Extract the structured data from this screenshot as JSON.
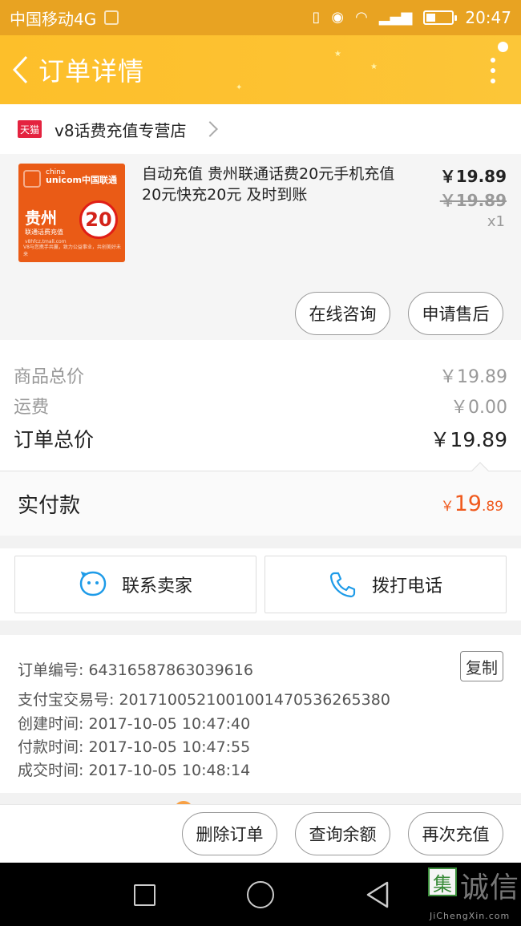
{
  "status_bar": {
    "carrier": "中国移动4G",
    "network": "4G",
    "time": "20:47",
    "battery_level": 0.35
  },
  "header": {
    "title": "订单详情"
  },
  "shop": {
    "badge": "天猫",
    "name": "v8话费充值专营店"
  },
  "product": {
    "thumb": {
      "brand_en_1": "china",
      "brand_en_2": "unicom",
      "brand_cn": "中国联通",
      "province": "贵州",
      "subtitle": "联通话费充值",
      "denomination": "20",
      "denomination_unit": "面值",
      "url": "v8hfcz.tmall.com",
      "footer": "V8与您携手共赢，致力公益事业，共创美好未来"
    },
    "title": "自动充值 贵州联通话费20元手机充值20元快充20元 及时到账",
    "price": "￥19.89",
    "original_price": "￥19.89",
    "quantity": "x1",
    "consult_label": "在线咨询",
    "after_sale_label": "申请售后"
  },
  "pricing": {
    "goods_total_label": "商品总价",
    "goods_total": "￥19.89",
    "shipping_label": "运费",
    "shipping": "￥0.00",
    "order_total_label": "订单总价",
    "order_total": "￥19.89"
  },
  "paid": {
    "label": "实付款",
    "currency": "￥",
    "integer": "19",
    "decimal": ".89"
  },
  "contact": {
    "seller_label": "联系卖家",
    "call_label": "拨打电话"
  },
  "order_info": {
    "order_no": "订单编号: 64316587863039616",
    "alipay_no": "支付宝交易号: 2017100521001001470536265380",
    "created": "创建时间: 2017-10-05 10:47:40",
    "paid_at": "付款时间: 2017-10-05 10:47:55",
    "completed": "成交时间: 2017-10-05 10:48:14",
    "copy_label": "复制"
  },
  "actions": {
    "delete_label": "删除订单",
    "balance_label": "查询余额",
    "recharge_label": "再次充值"
  },
  "watermark": {
    "mark": "集",
    "text": "诚信",
    "sub": "JiChengXin.com"
  },
  "colors": {
    "header": "#fdc02e",
    "status_bar": "#e8a322",
    "price_accent": "#f05a1e",
    "tmall": "#e4233f",
    "icon_blue": "#1e9be8"
  }
}
